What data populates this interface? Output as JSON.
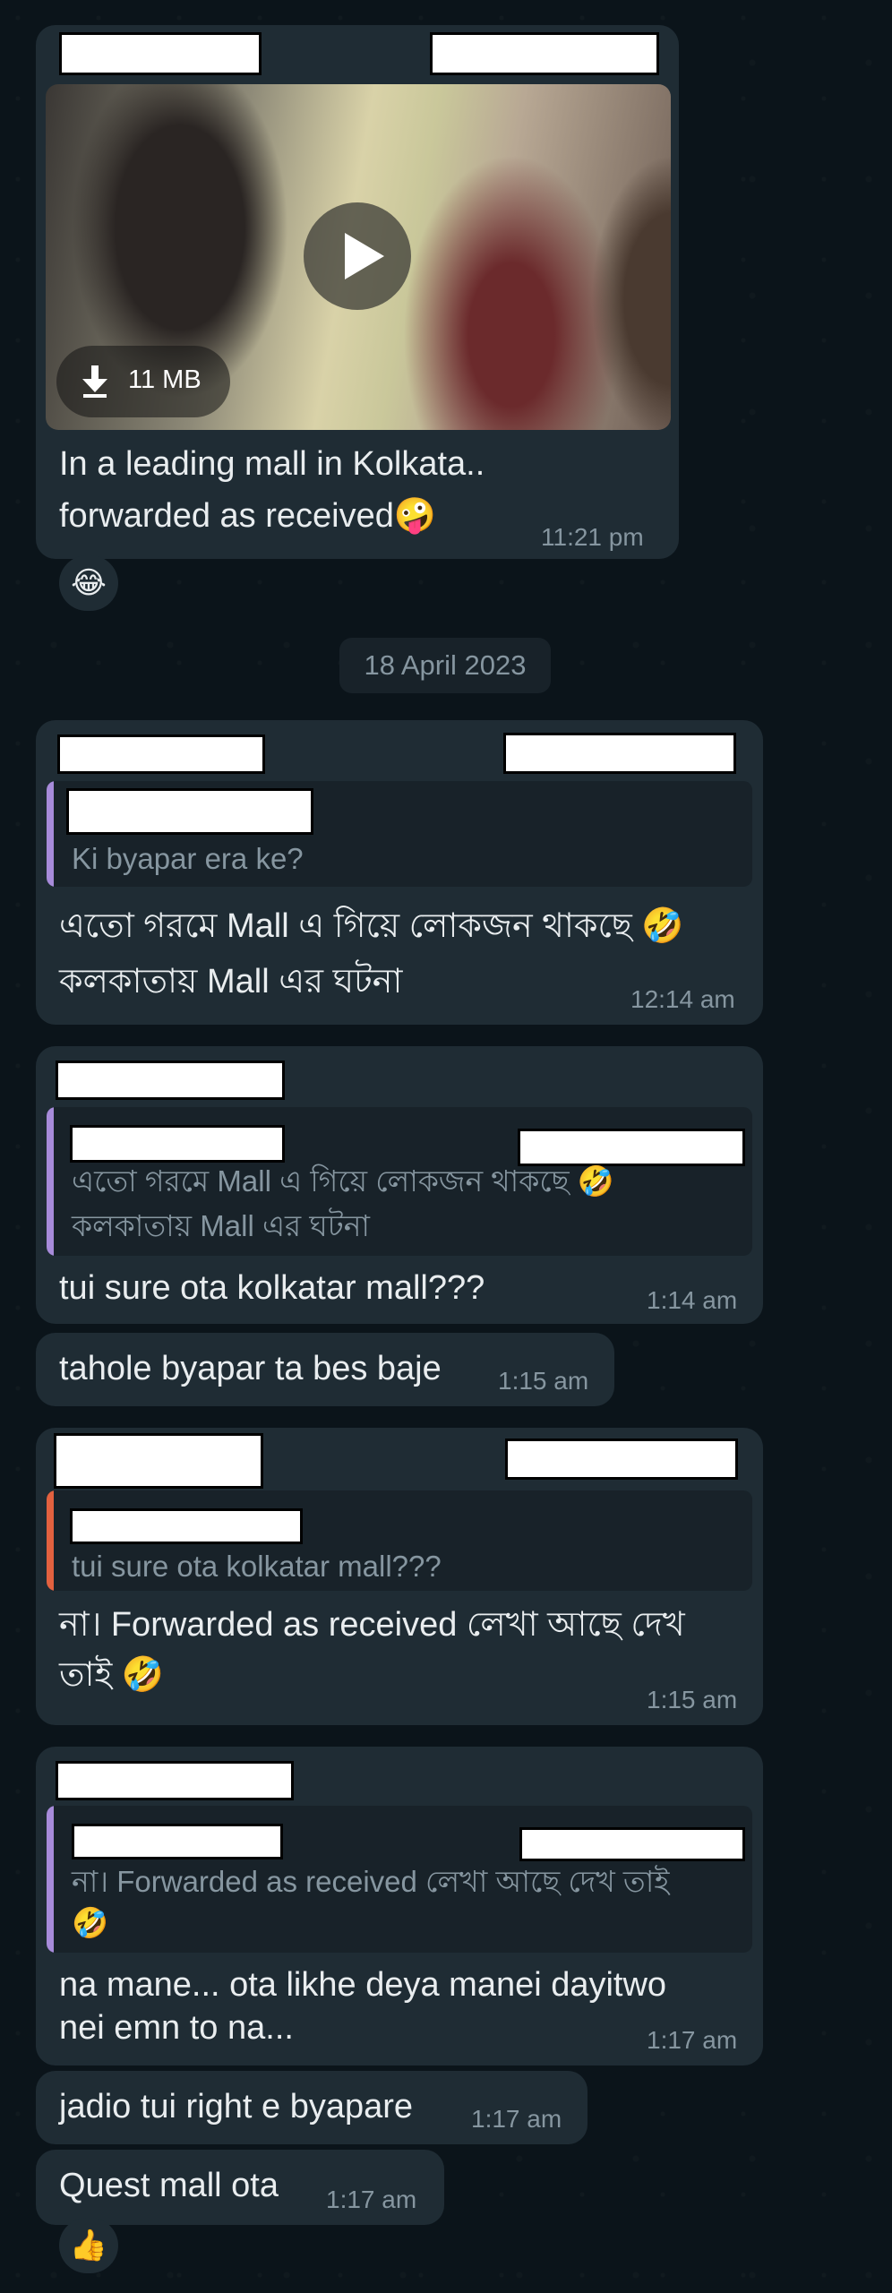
{
  "video_message": {
    "file_size": "11 MB",
    "caption_line1": "In a leading mall in Kolkata..",
    "caption_line2": "forwarded as received",
    "emoji": "🤪",
    "time": "11:21 pm",
    "reaction": "😂"
  },
  "date_divider": "18 April 2023",
  "messages": [
    {
      "quoted_text": "Ki byapar era ke?",
      "line1": "এতো গরমে Mall এ গিয়ে লোকজন থাকছে",
      "emoji": "🤣",
      "line2": "কলকাতায় Mall এর ঘটনা",
      "time": "12:14 am"
    },
    {
      "quoted_line1": "এতো গরমে Mall এ গিয়ে লোকজন থাকছে",
      "quoted_emoji": "🤣",
      "quoted_line2": "কলকাতায় Mall এর ঘটনা",
      "line1": "tui sure ota kolkatar mall???",
      "time": "1:14 am"
    },
    {
      "line1": "tahole byapar ta bes baje",
      "time": "1:15 am"
    },
    {
      "quoted_text": "tui sure ota kolkatar mall???",
      "line1": "না। Forwarded as received লেখা আছে দেখ",
      "line2": "তাই",
      "emoji": "🤣",
      "time": "1:15 am"
    },
    {
      "quoted_line1": "না। Forwarded as received লেখা আছে দেখ তাই",
      "quoted_emoji": "🤣",
      "line1": "na mane... ota likhe deya manei dayitwo",
      "line2": "nei emn to na...",
      "time": "1:17 am"
    },
    {
      "line1": "jadio tui right e byapare",
      "time": "1:17 am"
    },
    {
      "line1": "Quest mall ota",
      "time": "1:17 am",
      "reaction": "👍"
    }
  ],
  "colors": {
    "background": "#0b141a",
    "bubble": "#1f2c34",
    "quote_bar_purple": "#a78bda",
    "quote_bar_orange": "#e2613f"
  }
}
